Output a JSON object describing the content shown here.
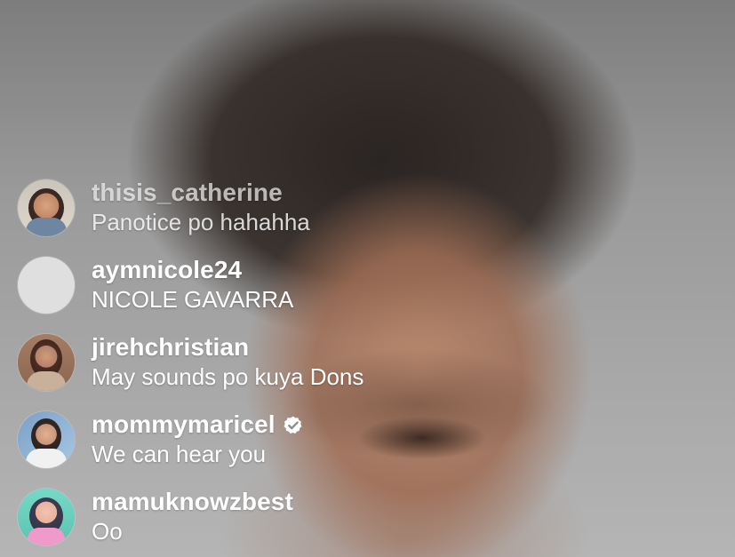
{
  "comments": [
    {
      "username": "thisis_catherine",
      "message": "Panotice po hahahha",
      "avatar": "portrait-avatar-icon",
      "verified": false
    },
    {
      "username": "aymnicole24",
      "message": "NICOLE GAVARRA",
      "avatar": "blank-avatar-icon",
      "verified": false
    },
    {
      "username": "jirehchristian",
      "message": "May sounds po kuya Dons",
      "avatar": "portrait-avatar-icon",
      "verified": false
    },
    {
      "username": "mommymaricel",
      "message": "We can hear you",
      "avatar": "portrait-avatar-icon",
      "verified": true,
      "badge_icon": "verified-badge-icon"
    },
    {
      "username": "mamuknowzbest",
      "message": "Oo",
      "avatar": "portrait-avatar-icon",
      "verified": false
    }
  ],
  "colors": {
    "text": "#ffffff",
    "muted_text": "#d9d9d9",
    "verified_badge": "#ffffff"
  }
}
